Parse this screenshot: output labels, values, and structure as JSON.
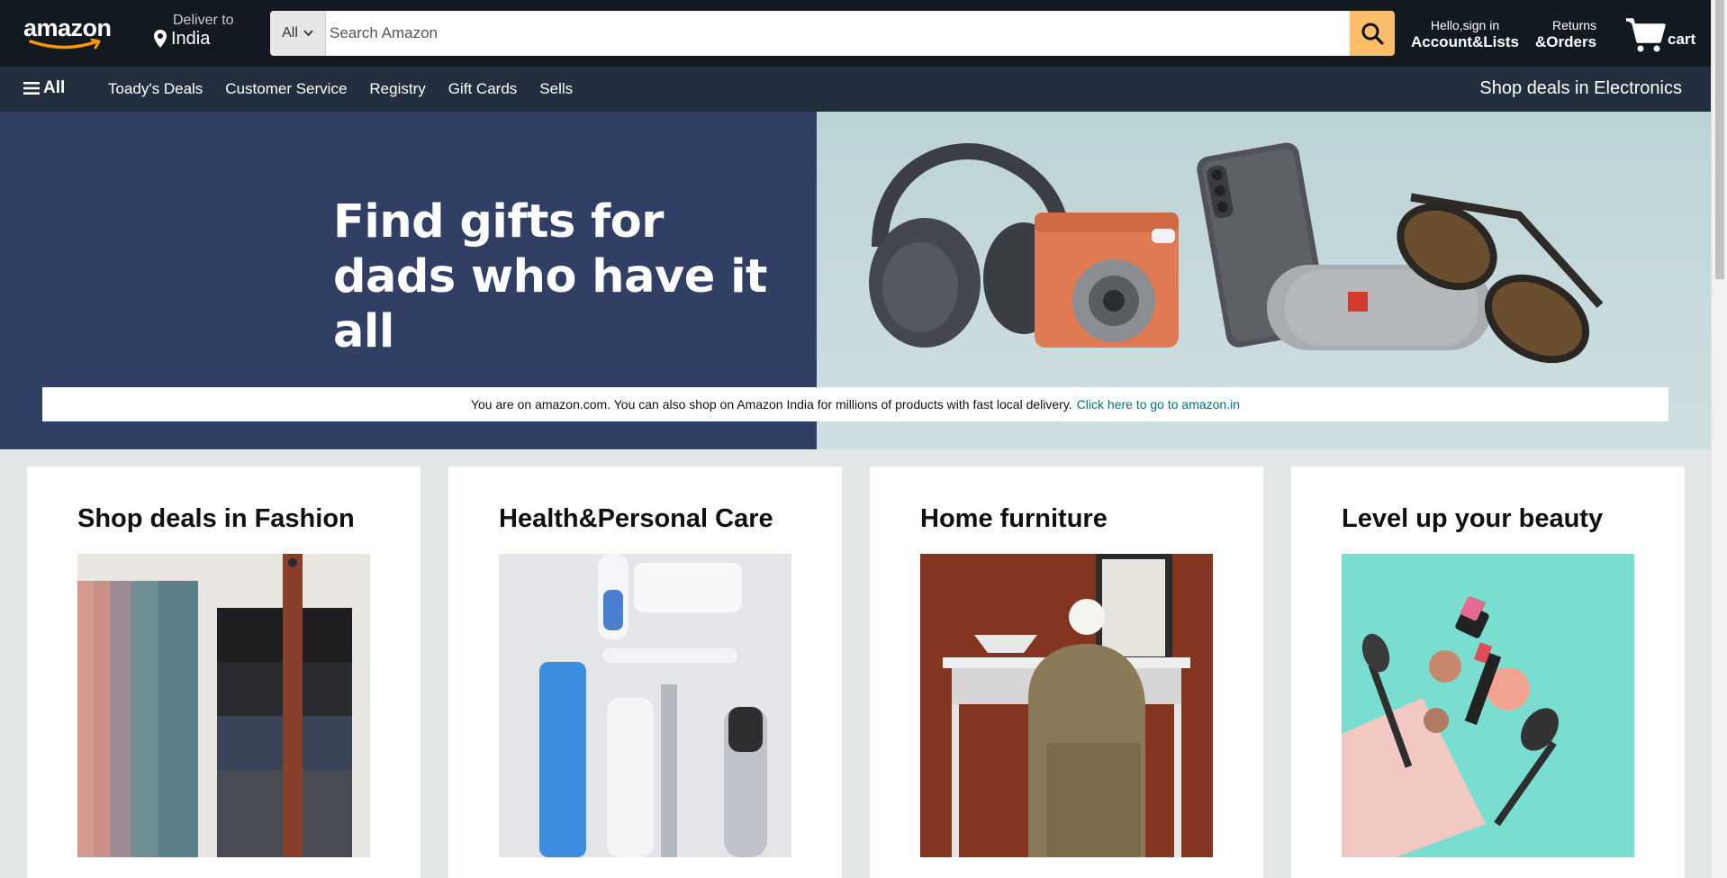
{
  "header": {
    "logo_text": "amazon",
    "deliver_label": "Deliver to",
    "deliver_location": "India",
    "search": {
      "category": "All",
      "placeholder": "Search Amazon"
    },
    "account_greeting": "Hello,sign in",
    "account_label": "Account&Lists",
    "returns_label": "Returns",
    "orders_label": "&Orders",
    "cart_label": "cart"
  },
  "subnav": {
    "all_label": "All",
    "links": [
      "Toady's Deals",
      "Customer Service",
      "Registry",
      "Gift Cards",
      "Sells"
    ],
    "right_label": "Shop deals in Electronics"
  },
  "hero": {
    "title_line1": "Find gifts for",
    "title_line2": "dads who have it all",
    "notice_text": "You are on amazon.com. You can also shop on Amazon India for millions of products with fast local delivery.",
    "notice_link": "Click here to go to amazon.in"
  },
  "cards": [
    {
      "title": "Shop deals in Fashion"
    },
    {
      "title": "Health&Personal Care"
    },
    {
      "title": "Home furniture"
    },
    {
      "title": "Level up your beauty"
    }
  ],
  "colors": {
    "nav_bg": "#131921",
    "subnav_bg": "#232f3e",
    "search_button": "#febd69",
    "hero_left": "#323f64",
    "link": "#007185",
    "page_bg": "#e3e6e6"
  }
}
